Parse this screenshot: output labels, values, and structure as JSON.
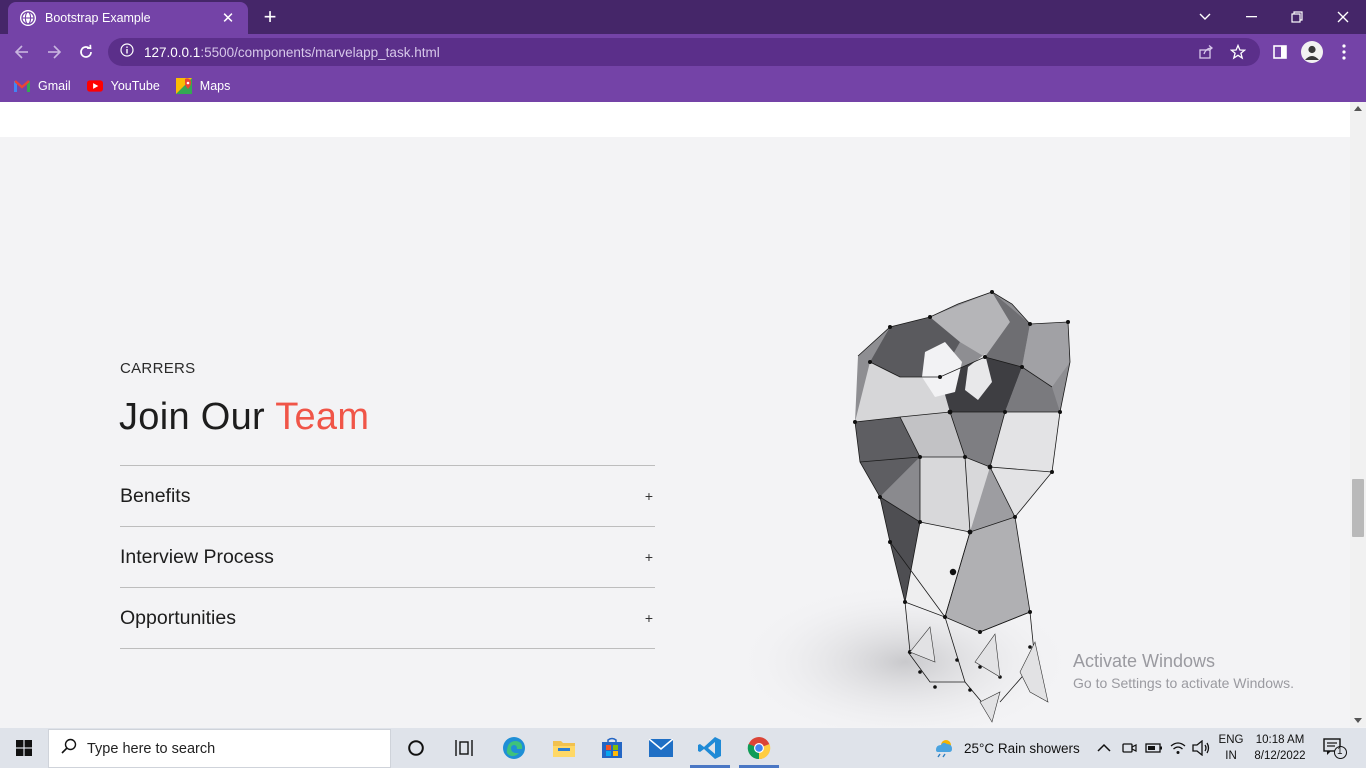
{
  "browser": {
    "tab_title": "Bootstrap Example",
    "url_host": "127.0.0.1",
    "url_path": ":5500/components/marvelapp_task.html",
    "bookmarks": [
      {
        "label": "Gmail",
        "icon": "gmail-icon"
      },
      {
        "label": "YouTube",
        "icon": "youtube-icon"
      },
      {
        "label": "Maps",
        "icon": "maps-icon"
      }
    ],
    "theme_color": "#7443a7"
  },
  "page": {
    "eyebrow": "CARRERS",
    "headline_prefix": "Join Our",
    "headline_accent": "Team",
    "accent_color": "#f05548",
    "accordion": [
      {
        "label": "Benefits",
        "toggle": "+"
      },
      {
        "label": "Interview Process",
        "toggle": "+"
      },
      {
        "label": "Opportunities",
        "toggle": "+"
      }
    ],
    "image": "low-poly-fist-illustration"
  },
  "watermark": {
    "line1": "Activate Windows",
    "line2": "Go to Settings to activate Windows."
  },
  "taskbar": {
    "search_placeholder": "Type here to search",
    "weather": "25°C  Rain showers",
    "lang_top": "ENG",
    "lang_bottom": "IN",
    "time": "10:18 AM",
    "date": "8/12/2022",
    "notification_count": "1"
  }
}
